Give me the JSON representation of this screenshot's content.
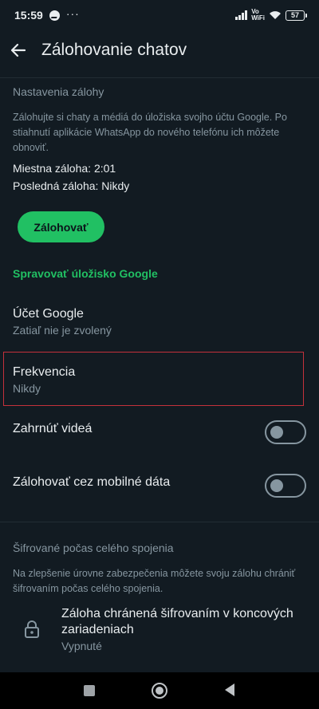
{
  "status_bar": {
    "time": "15:59",
    "dots": "···",
    "network_label_top": "Vo",
    "network_label_bottom": "WiFi",
    "battery": "57"
  },
  "app_bar": {
    "title": "Zálohovanie chatov"
  },
  "backup_settings": {
    "header": "Nastavenia zálohy",
    "description": "Zálohujte si chaty a médiá do úložiska svojho účtu Google. Po stiahnutí aplikácie WhatsApp do nového telefónu ich môžete obnoviť.",
    "local_backup": "Miestna záloha: 2:01",
    "last_backup": "Posledná záloha: Nikdy",
    "backup_button": "Zálohovať"
  },
  "manage_storage_link": "Spravovať úložisko Google",
  "google_account": {
    "title": "Účet Google",
    "subtitle": "Zatiaľ nie je zvolený"
  },
  "frequency": {
    "title": "Frekvencia",
    "subtitle": "Nikdy"
  },
  "include_videos": {
    "title": "Zahrnúť videá",
    "enabled": false
  },
  "mobile_data": {
    "title": "Zálohovať cez mobilné dáta",
    "enabled": false
  },
  "encryption": {
    "header": "Šifrované počas celého spojenia",
    "description": "Na zlepšenie úrovne zabezpečenia môžete svoju zálohu chrániť šifrovaním počas celého spojenia.",
    "item_title": "Záloha chránená šifrovaním v koncových zariadeniach",
    "item_status": "Vypnuté"
  },
  "colors": {
    "background": "#121b22",
    "accent": "#21c063",
    "secondary_text": "#8696a0",
    "highlight_border": "#c4313b"
  }
}
